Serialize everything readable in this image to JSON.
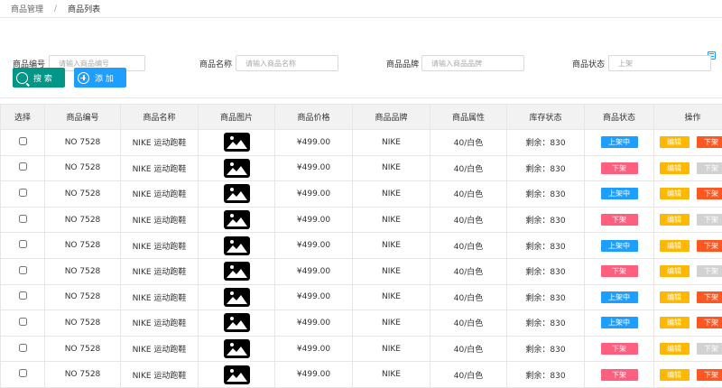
{
  "breadcrumb": {
    "parent": "商品管理",
    "separator": "/",
    "current": "商品列表"
  },
  "filters": {
    "code_label": "商品编号",
    "code_placeholder": "请输入商品编号",
    "name_label": "商品名称",
    "name_placeholder": "请输入商品名称",
    "brand_label": "商品品牌",
    "brand_placeholder": "请输入商品品牌",
    "status_label": "商品状态",
    "status_placeholder": "上架"
  },
  "buttons": {
    "search": "搜 索",
    "add": "添 加"
  },
  "table": {
    "headers": [
      "选择",
      "商品编号",
      "商品名称",
      "商品图片",
      "商品价格",
      "商品品牌",
      "商品属性",
      "库存状态",
      "商品状态",
      "操作"
    ],
    "rows": [
      {
        "code": "NO 7528",
        "name": "NIKE 运动跑鞋",
        "price": "¥499.00",
        "brand": "NIKE",
        "attr": "40/白色",
        "stock": "剩余：830",
        "status": "上架中",
        "status_type": "on",
        "edit": "编辑",
        "action": "下架",
        "action_type": "down"
      },
      {
        "code": "NO 7528",
        "name": "NIKE 运动跑鞋",
        "price": "¥499.00",
        "brand": "NIKE",
        "attr": "40/白色",
        "stock": "剩余：830",
        "status": "下架",
        "status_type": "off",
        "edit": "编辑",
        "action": "下架",
        "action_type": "disabled"
      },
      {
        "code": "NO 7528",
        "name": "NIKE 运动跑鞋",
        "price": "¥499.00",
        "brand": "NIKE",
        "attr": "40/白色",
        "stock": "剩余：830",
        "status": "上架中",
        "status_type": "on",
        "edit": "编辑",
        "action": "下架",
        "action_type": "down"
      },
      {
        "code": "NO 7528",
        "name": "NIKE 运动跑鞋",
        "price": "¥499.00",
        "brand": "NIKE",
        "attr": "40/白色",
        "stock": "剩余：830",
        "status": "下架",
        "status_type": "off",
        "edit": "编辑",
        "action": "下架",
        "action_type": "disabled"
      },
      {
        "code": "NO 7528",
        "name": "NIKE 运动跑鞋",
        "price": "¥499.00",
        "brand": "NIKE",
        "attr": "40/白色",
        "stock": "剩余：830",
        "status": "上架中",
        "status_type": "on",
        "edit": "编辑",
        "action": "下架",
        "action_type": "down"
      },
      {
        "code": "NO 7528",
        "name": "NIKE 运动跑鞋",
        "price": "¥499.00",
        "brand": "NIKE",
        "attr": "40/白色",
        "stock": "剩余：830",
        "status": "下架",
        "status_type": "off",
        "edit": "编辑",
        "action": "下架",
        "action_type": "disabled"
      },
      {
        "code": "NO 7528",
        "name": "NIKE 运动跑鞋",
        "price": "¥499.00",
        "brand": "NIKE",
        "attr": "40/白色",
        "stock": "剩余：830",
        "status": "上架中",
        "status_type": "on",
        "edit": "编辑",
        "action": "下架",
        "action_type": "down"
      },
      {
        "code": "NO 7528",
        "name": "NIKE 运动跑鞋",
        "price": "¥499.00",
        "brand": "NIKE",
        "attr": "40/白色",
        "stock": "剩余：830",
        "status": "上架中",
        "status_type": "on",
        "edit": "编辑",
        "action": "下架",
        "action_type": "down"
      },
      {
        "code": "NO 7528",
        "name": "NIKE 运动跑鞋",
        "price": "¥499.00",
        "brand": "NIKE",
        "attr": "40/白色",
        "stock": "剩余：830",
        "status": "下架",
        "status_type": "off",
        "edit": "编辑",
        "action": "下架",
        "action_type": "disabled"
      },
      {
        "code": "NO 7528",
        "name": "NIKE 运动跑鞋",
        "price": "¥499.00",
        "brand": "NIKE",
        "attr": "40/白色",
        "stock": "剩余：830",
        "status": "下架",
        "status_type": "off",
        "edit": "编辑",
        "action": "下架",
        "action_type": "down"
      }
    ]
  },
  "icons": {
    "image": "image-icon",
    "search": "search-icon",
    "add": "plus-circle-icon",
    "filter_toggle": "list-icon"
  },
  "colors": {
    "search_button": "#009688",
    "add_button": "#1e9fff",
    "status_on": "#1e9fff",
    "status_off": "#ff5f7e",
    "edit": "#ffb800",
    "down": "#ff5722",
    "disabled": "#d2d2d2"
  }
}
